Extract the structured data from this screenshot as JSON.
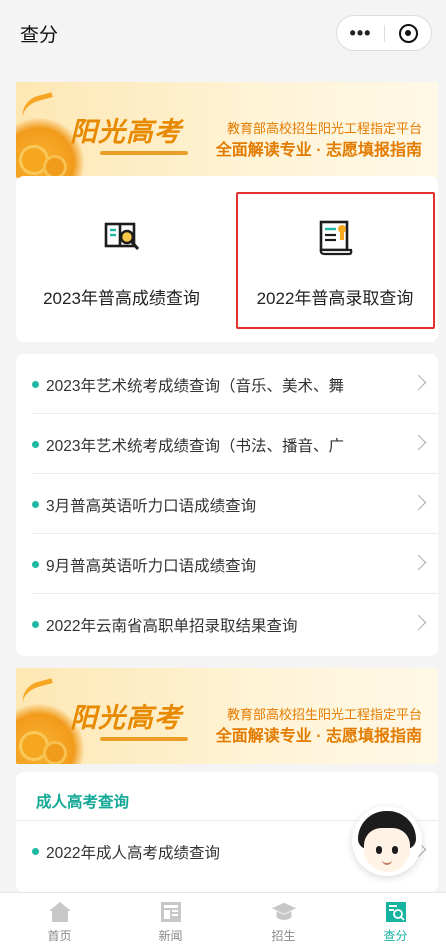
{
  "header": {
    "title": "查分",
    "more_icon": "more-dots-icon",
    "close_icon": "target-close-icon"
  },
  "banner": {
    "logo": "阳光高考",
    "line1": "教育部高校招生阳光工程指定平台",
    "line2": "全面解读专业 · 志愿填报指南"
  },
  "quick": [
    {
      "label": "2023年普高成绩查询",
      "icon": "book-search-icon"
    },
    {
      "label": "2022年普高录取查询",
      "icon": "certificate-icon"
    }
  ],
  "list": [
    {
      "label": "2023年艺术统考成绩查询（音乐、美术、舞"
    },
    {
      "label": "2023年艺术统考成绩查询（书法、播音、广"
    },
    {
      "label": "3月普高英语听力口语成绩查询"
    },
    {
      "label": "9月普高英语听力口语成绩查询"
    },
    {
      "label": "2022年云南省高职单招录取结果查询"
    }
  ],
  "adult": {
    "heading": "成人高考查询",
    "items": [
      {
        "label": "2022年成人高考成绩查询"
      }
    ]
  },
  "tabs": [
    {
      "label": "首页",
      "icon": "home-icon"
    },
    {
      "label": "新闻",
      "icon": "news-icon"
    },
    {
      "label": "招生",
      "icon": "graduation-cap-icon"
    },
    {
      "label": "查分",
      "icon": "score-query-icon"
    }
  ],
  "colors": {
    "accent": "#17b3a1",
    "highlight_box": "#e53030",
    "banner_text": "#e37b00"
  }
}
